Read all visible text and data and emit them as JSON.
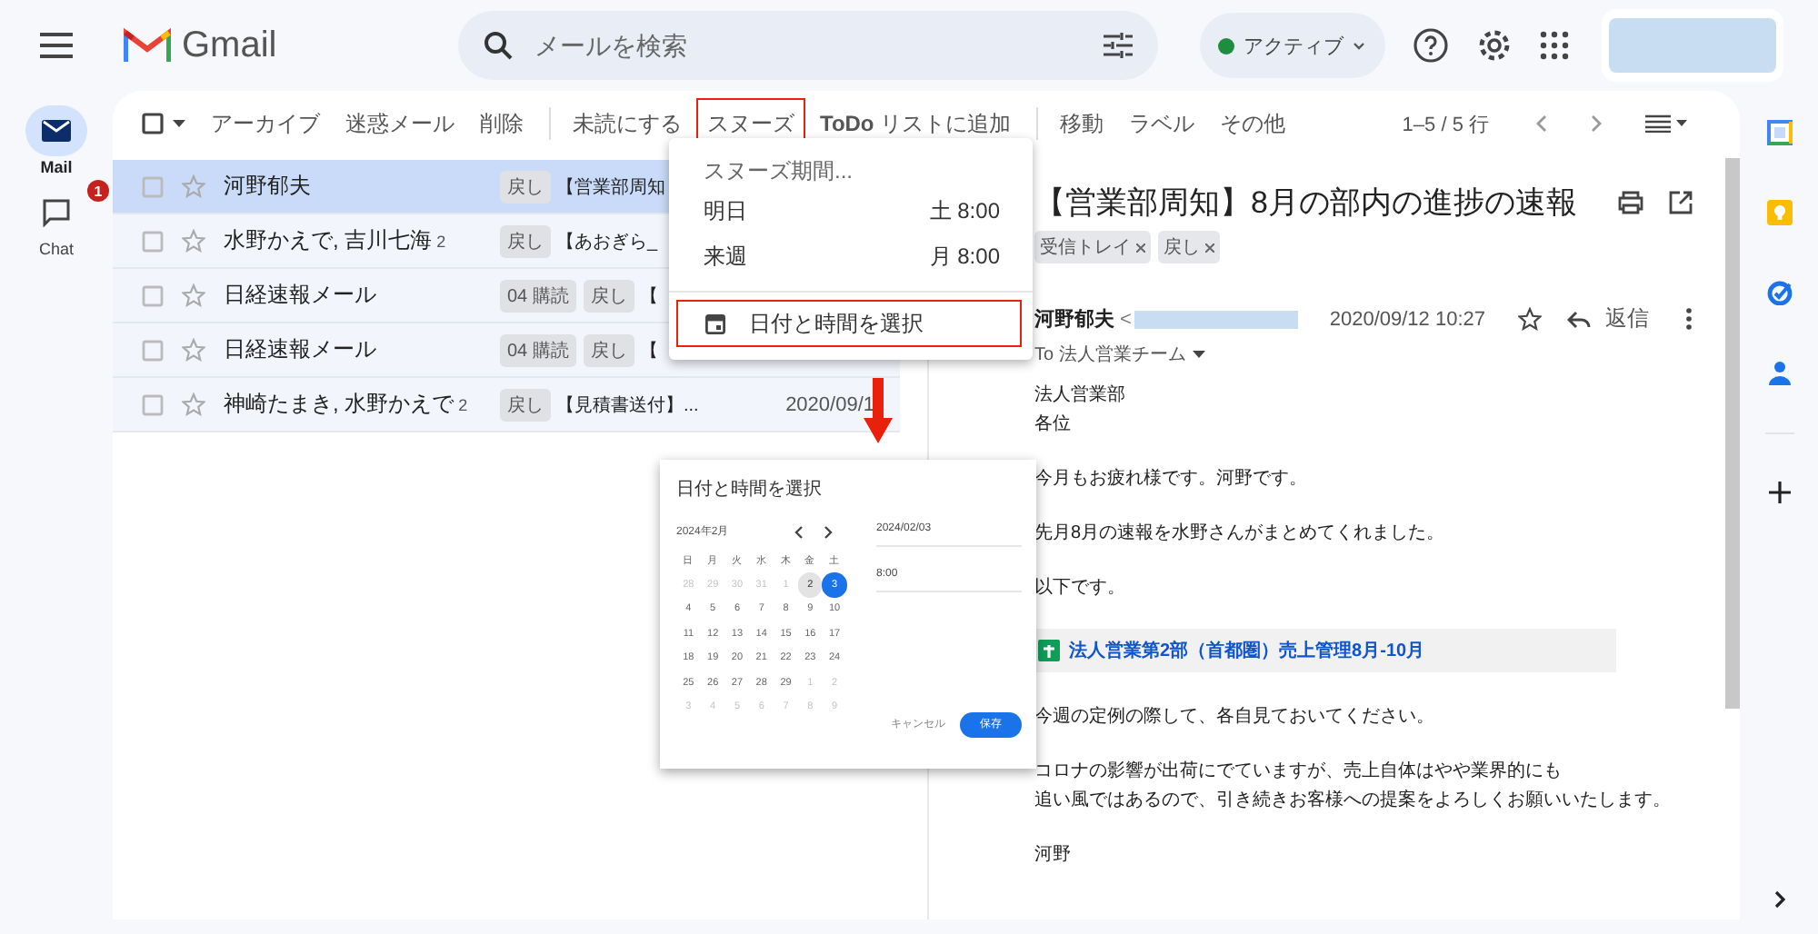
{
  "rail": {
    "items": [
      {
        "kind": "mail",
        "label": "Mail",
        "selected": true
      },
      {
        "kind": "chat",
        "label": "Chat",
        "selected": false,
        "badge": "1"
      }
    ]
  },
  "topbar": {
    "logo_text": "Gmail",
    "search": {
      "placeholder": "メールを検索"
    },
    "status": "アクティブ"
  },
  "toolbar": {
    "select_all_checked": false,
    "actions": [
      {
        "label": "アーカイブ",
        "highlighted": false,
        "divider_after": false
      },
      {
        "label": "迷惑メール",
        "highlighted": false,
        "divider_after": false
      },
      {
        "label": "削除",
        "highlighted": false,
        "divider_after": true
      },
      {
        "label": "未読にする",
        "highlighted": false,
        "divider_after": false
      },
      {
        "label": "スヌーズ",
        "highlighted": true,
        "divider_after": false
      },
      {
        "label": "**ToDo** リストに追加",
        "highlighted": false,
        "divider_after": true
      },
      {
        "label": "移動",
        "highlighted": false,
        "divider_after": false
      },
      {
        "label": "ラベル",
        "highlighted": false,
        "divider_after": false
      },
      {
        "label": "その他",
        "highlighted": false,
        "divider_after": false
      }
    ],
    "range": "1–5 / 5 行"
  },
  "messages": [
    {
      "sender": "河野郁夫",
      "tags": [
        "戻し"
      ],
      "subject": "【営業部周知",
      "selected": true,
      "checked": false
    },
    {
      "sender": "水野かえで, 吉川七海",
      "count": "2",
      "tags": [
        "戻し"
      ],
      "subject": "【あおぎら_",
      "selected": false,
      "checked": false
    },
    {
      "sender": "日経速報メール",
      "tags": [
        "04 購読",
        "戻し"
      ],
      "subject": "【",
      "selected": false,
      "checked": false
    },
    {
      "sender": "日経速報メール",
      "tags": [
        "04 購読",
        "戻し"
      ],
      "subject": "【",
      "selected": false,
      "checked": false
    },
    {
      "sender": "神崎たまき, 水野かえで",
      "count": "2",
      "tags": [
        "戻し"
      ],
      "subject": "【見積書送付】...",
      "date": "2020/09/1",
      "selected": false,
      "checked": false
    }
  ],
  "snooze_menu": {
    "header": "スヌーズ期間...",
    "options": [
      {
        "label": "明日",
        "time": "土 8:00"
      },
      {
        "label": "来週",
        "time": "月 8:00"
      }
    ],
    "custom": {
      "label": "日付と時間を選択",
      "highlighted": true
    }
  },
  "reading": {
    "subject": "【営業部周知】8月の部内の進捗の速報",
    "labels": [
      "受信トレイ",
      "戻し"
    ],
    "sender_name": "河野郁夫",
    "email_prefix": "<",
    "date": "2020/09/12 10:27",
    "reply": "返信",
    "to": "To 法人営業チーム",
    "body": [
      {
        "kind": "text",
        "lines": [
          "法人営業部",
          "各位"
        ]
      },
      {
        "kind": "text",
        "lines": [
          "今月もお疲れ様です。河野です。"
        ]
      },
      {
        "kind": "text",
        "lines": [
          "先月8月の速報を水野さんがまとめてくれました。"
        ]
      },
      {
        "kind": "text",
        "lines": [
          "以下です。"
        ]
      },
      {
        "kind": "file",
        "label": "法人営業第2部（首都圏）売上管理8月-10月"
      },
      {
        "kind": "text",
        "lines": [
          "今週の定例の際して、各自見ておいてください。"
        ]
      },
      {
        "kind": "text",
        "lines": [
          "コロナの影響が出荷にでていますが、売上自体はやや業界的にも",
          "追い風ではあるので、引き続きお客様への提案をよろしくお願いいたします。"
        ]
      },
      {
        "kind": "text",
        "lines": [
          "河野"
        ]
      }
    ]
  },
  "picker": {
    "title": "日付と時間を選択",
    "month": "2024年2月",
    "weekdays": [
      "日",
      "月",
      "火",
      "水",
      "木",
      "金",
      "土"
    ],
    "weeks": [
      [
        {
          "label": "28",
          "outside": true,
          "today": false,
          "selected": false
        },
        {
          "label": "29",
          "outside": true,
          "today": false,
          "selected": false
        },
        {
          "label": "30",
          "outside": true,
          "today": false,
          "selected": false
        },
        {
          "label": "31",
          "outside": true,
          "today": false,
          "selected": false
        },
        {
          "label": "1",
          "outside": true,
          "today": false,
          "selected": false
        },
        {
          "label": "2",
          "outside": false,
          "today": true,
          "selected": false
        },
        {
          "label": "3",
          "outside": false,
          "today": false,
          "selected": true
        }
      ],
      [
        {
          "label": "4",
          "outside": false,
          "today": false,
          "selected": false
        },
        {
          "label": "5",
          "outside": false,
          "today": false,
          "selected": false
        },
        {
          "label": "6",
          "outside": false,
          "today": false,
          "selected": false
        },
        {
          "label": "7",
          "outside": false,
          "today": false,
          "selected": false
        },
        {
          "label": "8",
          "outside": false,
          "today": false,
          "selected": false
        },
        {
          "label": "9",
          "outside": false,
          "today": false,
          "selected": false
        },
        {
          "label": "10",
          "outside": false,
          "today": false,
          "selected": false
        }
      ],
      [
        {
          "label": "11",
          "outside": false,
          "today": false,
          "selected": false
        },
        {
          "label": "12",
          "outside": false,
          "today": false,
          "selected": false
        },
        {
          "label": "13",
          "outside": false,
          "today": false,
          "selected": false
        },
        {
          "label": "14",
          "outside": false,
          "today": false,
          "selected": false
        },
        {
          "label": "15",
          "outside": false,
          "today": false,
          "selected": false
        },
        {
          "label": "16",
          "outside": false,
          "today": false,
          "selected": false
        },
        {
          "label": "17",
          "outside": false,
          "today": false,
          "selected": false
        }
      ],
      [
        {
          "label": "18",
          "outside": false,
          "today": false,
          "selected": false
        },
        {
          "label": "19",
          "outside": false,
          "today": false,
          "selected": false
        },
        {
          "label": "20",
          "outside": false,
          "today": false,
          "selected": false
        },
        {
          "label": "21",
          "outside": false,
          "today": false,
          "selected": false
        },
        {
          "label": "22",
          "outside": false,
          "today": false,
          "selected": false
        },
        {
          "label": "23",
          "outside": false,
          "today": false,
          "selected": false
        },
        {
          "label": "24",
          "outside": false,
          "today": false,
          "selected": false
        }
      ],
      [
        {
          "label": "25",
          "outside": false,
          "today": false,
          "selected": false
        },
        {
          "label": "26",
          "outside": false,
          "today": false,
          "selected": false
        },
        {
          "label": "27",
          "outside": false,
          "today": false,
          "selected": false
        },
        {
          "label": "28",
          "outside": false,
          "today": false,
          "selected": false
        },
        {
          "label": "29",
          "outside": false,
          "today": false,
          "selected": false
        },
        {
          "label": "1",
          "outside": true,
          "today": false,
          "selected": false
        },
        {
          "label": "2",
          "outside": true,
          "today": false,
          "selected": false
        }
      ],
      [
        {
          "label": "3",
          "outside": true,
          "today": false,
          "selected": false
        },
        {
          "label": "4",
          "outside": true,
          "today": false,
          "selected": false
        },
        {
          "label": "5",
          "outside": true,
          "today": false,
          "selected": false
        },
        {
          "label": "6",
          "outside": true,
          "today": false,
          "selected": false
        },
        {
          "label": "7",
          "outside": true,
          "today": false,
          "selected": false
        },
        {
          "label": "8",
          "outside": true,
          "today": false,
          "selected": false
        },
        {
          "label": "9",
          "outside": true,
          "today": false,
          "selected": false
        }
      ]
    ],
    "date": "2024/02/03",
    "time": "8:00",
    "cancel": "キャンセル",
    "save": "保存"
  }
}
